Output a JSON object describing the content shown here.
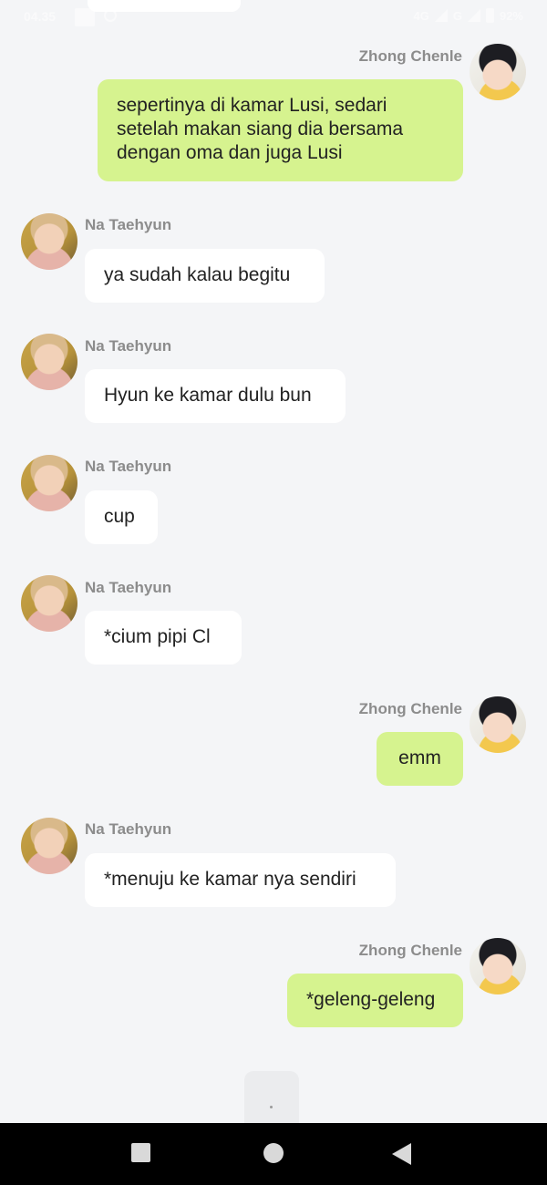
{
  "status_bar": {
    "time": "04.35",
    "network": "4G",
    "network2": "G",
    "battery": "92%"
  },
  "messages": [
    {
      "sender": "Zhong Chenle",
      "side": "out",
      "lines": [
        "sepertinya di kamar Lusi, sedari",
        "setelah makan siang dia bersama",
        "dengan oma dan juga Lusi"
      ]
    },
    {
      "sender": "Na Taehyun",
      "side": "in",
      "lines": [
        "ya sudah kalau begitu"
      ]
    },
    {
      "sender": "Na Taehyun",
      "side": "in",
      "lines": [
        "Hyun ke kamar dulu bun"
      ]
    },
    {
      "sender": "Na Taehyun",
      "side": "in",
      "lines": [
        "cup"
      ]
    },
    {
      "sender": "Na Taehyun",
      "side": "in",
      "lines": [
        "*cium pipi Cl"
      ]
    },
    {
      "sender": "Zhong Chenle",
      "side": "out",
      "lines": [
        "emm"
      ]
    },
    {
      "sender": "Na Taehyun",
      "side": "in",
      "lines": [
        "*menuju ke kamar nya sendiri"
      ]
    },
    {
      "sender": "Zhong Chenle",
      "side": "out",
      "lines": [
        "*geleng-geleng"
      ]
    }
  ],
  "typing_indicator": {
    "label": "."
  },
  "navbar": {
    "icons": [
      "recents-square-icon",
      "home-circle-icon",
      "back-triangle-icon"
    ]
  }
}
